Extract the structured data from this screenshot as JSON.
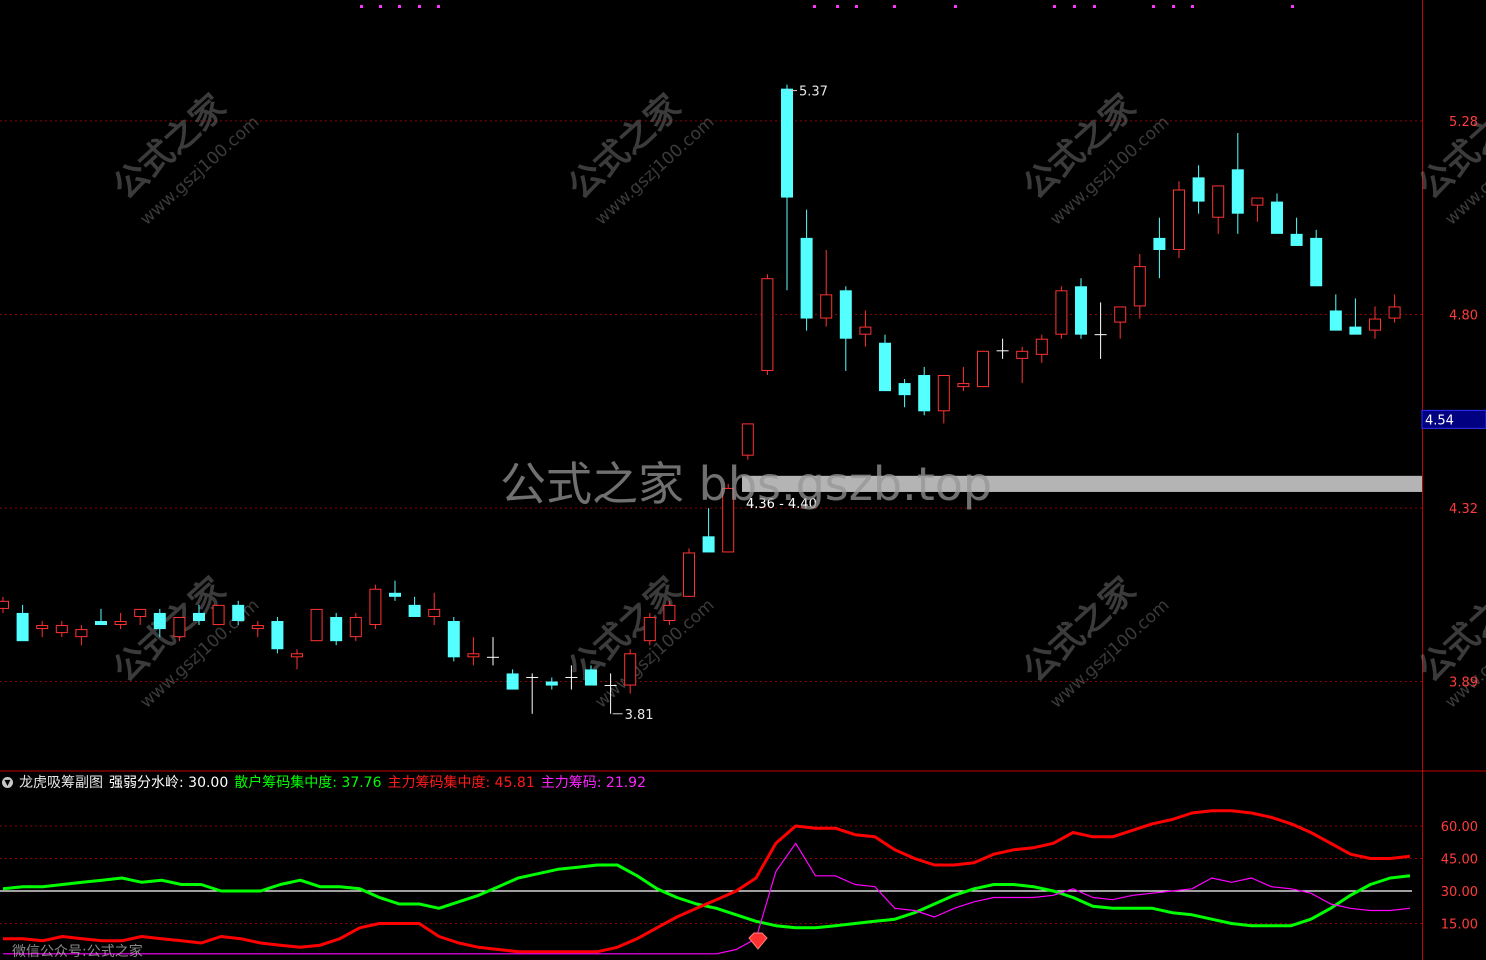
{
  "colors": {
    "background": "#000000",
    "up_candle": "#ff3232",
    "down_candle": "#54ffff",
    "doji": "#ffffff",
    "grid": "#8b0000",
    "axis_line": "#c00000",
    "axis_text": "#ff3c3c",
    "retail_line": "#00ff00",
    "main_line": "#ff0000",
    "main_chips_line": "#ff00ff",
    "threshold_line": "#ffffff",
    "price_tag_bg": "#000080",
    "band": "#b4b4b4",
    "watermark": "#8c8c8c"
  },
  "watermark_center": "公式之家 bbs.gszb.top",
  "watermark_tiles": [
    "公式之家",
    "www.gszj100.com"
  ],
  "footer_text": "微信公众号:公式之家",
  "price_panel": {
    "price_tags": [
      "5.28",
      "4.80",
      "4.32",
      "3.89"
    ],
    "current_price": "4.54",
    "high_label": "5.37",
    "low_label": "3.81",
    "band_label": "4.36 - 4.40",
    "band_low": 4.36,
    "band_high": 4.4
  },
  "indicator_panel": {
    "title": "龙虎吸筹副图",
    "threshold_label": "强弱分水岭: 30.00",
    "retail_label": "散户筹码集中度: 37.76",
    "main_label": "主力筹码集中度: 45.81",
    "main_chips_label": "主力筹码: 21.92",
    "tick_labels": [
      "60.00",
      "45.00",
      "30.00",
      "15.00"
    ]
  },
  "chart_data": [
    {
      "type": "candlestick",
      "title": "",
      "ylim": [
        3.74,
        5.56
      ],
      "gridlines": [
        5.28,
        4.8,
        4.32,
        3.89
      ],
      "candles": [
        {
          "o": 4.07,
          "h": 4.1,
          "l": 4.06,
          "c": 4.09
        },
        {
          "o": 4.06,
          "h": 4.08,
          "l": 4.0,
          "c": 3.99
        },
        {
          "o": 4.02,
          "h": 4.04,
          "l": 4.0,
          "c": 4.03
        },
        {
          "o": 4.01,
          "h": 4.04,
          "l": 4.0,
          "c": 4.03
        },
        {
          "o": 4.0,
          "h": 4.03,
          "l": 3.98,
          "c": 4.02
        },
        {
          "o": 4.04,
          "h": 4.07,
          "l": 4.03,
          "c": 4.03
        },
        {
          "o": 4.03,
          "h": 4.06,
          "l": 4.02,
          "c": 4.04
        },
        {
          "o": 4.05,
          "h": 4.07,
          "l": 4.03,
          "c": 4.07
        },
        {
          "o": 4.06,
          "h": 4.07,
          "l": 4.0,
          "c": 4.02
        },
        {
          "o": 4.0,
          "h": 4.05,
          "l": 3.99,
          "c": 4.05
        },
        {
          "o": 4.06,
          "h": 4.08,
          "l": 4.03,
          "c": 4.04
        },
        {
          "o": 4.03,
          "h": 4.08,
          "l": 4.03,
          "c": 4.08
        },
        {
          "o": 4.08,
          "h": 4.09,
          "l": 4.03,
          "c": 4.04
        },
        {
          "o": 4.02,
          "h": 4.04,
          "l": 4.0,
          "c": 4.03
        },
        {
          "o": 4.04,
          "h": 4.05,
          "l": 3.96,
          "c": 3.97
        },
        {
          "o": 3.95,
          "h": 3.97,
          "l": 3.92,
          "c": 3.96
        },
        {
          "o": 3.99,
          "h": 4.07,
          "l": 3.99,
          "c": 4.07
        },
        {
          "o": 4.05,
          "h": 4.06,
          "l": 3.98,
          "c": 3.99
        },
        {
          "o": 4.0,
          "h": 4.06,
          "l": 3.99,
          "c": 4.05
        },
        {
          "o": 4.03,
          "h": 4.13,
          "l": 4.02,
          "c": 4.12
        },
        {
          "o": 4.11,
          "h": 4.14,
          "l": 4.09,
          "c": 4.1
        },
        {
          "o": 4.08,
          "h": 4.1,
          "l": 4.05,
          "c": 4.05
        },
        {
          "o": 4.05,
          "h": 4.11,
          "l": 4.03,
          "c": 4.07
        },
        {
          "o": 4.04,
          "h": 4.05,
          "l": 3.94,
          "c": 3.95
        },
        {
          "o": 3.95,
          "h": 4.0,
          "l": 3.93,
          "c": 3.96
        },
        {
          "o": 3.95,
          "h": 4.0,
          "l": 3.93,
          "c": 3.95
        },
        {
          "o": 3.91,
          "h": 3.92,
          "l": 3.87,
          "c": 3.87
        },
        {
          "o": 3.9,
          "h": 3.91,
          "l": 3.81,
          "c": 3.9
        },
        {
          "o": 3.89,
          "h": 3.9,
          "l": 3.87,
          "c": 3.88
        },
        {
          "o": 3.9,
          "h": 3.93,
          "l": 3.87,
          "c": 3.9
        },
        {
          "o": 3.92,
          "h": 3.93,
          "l": 3.88,
          "c": 3.88
        },
        {
          "o": 3.88,
          "h": 3.91,
          "l": 3.81,
          "c": 3.88
        },
        {
          "o": 3.88,
          "h": 3.97,
          "l": 3.86,
          "c": 3.96
        },
        {
          "o": 3.99,
          "h": 4.06,
          "l": 3.98,
          "c": 4.05
        },
        {
          "o": 4.04,
          "h": 4.09,
          "l": 4.03,
          "c": 4.08
        },
        {
          "o": 4.1,
          "h": 4.22,
          "l": 4.1,
          "c": 4.21
        },
        {
          "o": 4.25,
          "h": 4.32,
          "l": 4.21,
          "c": 4.21
        },
        {
          "o": 4.21,
          "h": 4.38,
          "l": 4.21,
          "c": 4.37
        },
        {
          "o": 4.45,
          "h": 4.52,
          "l": 4.44,
          "c": 4.53
        },
        {
          "o": 4.66,
          "h": 4.9,
          "l": 4.65,
          "c": 4.89
        },
        {
          "o": 5.36,
          "h": 5.37,
          "l": 4.86,
          "c": 5.09
        },
        {
          "o": 4.99,
          "h": 5.06,
          "l": 4.76,
          "c": 4.79
        },
        {
          "o": 4.79,
          "h": 4.96,
          "l": 4.77,
          "c": 4.85
        },
        {
          "o": 4.86,
          "h": 4.87,
          "l": 4.66,
          "c": 4.74
        },
        {
          "o": 4.75,
          "h": 4.81,
          "l": 4.72,
          "c": 4.77
        },
        {
          "o": 4.73,
          "h": 4.75,
          "l": 4.62,
          "c": 4.61
        },
        {
          "o": 4.63,
          "h": 4.64,
          "l": 4.57,
          "c": 4.6
        },
        {
          "o": 4.65,
          "h": 4.67,
          "l": 4.55,
          "c": 4.56
        },
        {
          "o": 4.56,
          "h": 4.64,
          "l": 4.53,
          "c": 4.65
        },
        {
          "o": 4.62,
          "h": 4.67,
          "l": 4.61,
          "c": 4.63
        },
        {
          "o": 4.62,
          "h": 4.71,
          "l": 4.62,
          "c": 4.71
        },
        {
          "o": 4.71,
          "h": 4.74,
          "l": 4.69,
          "c": 4.71
        },
        {
          "o": 4.69,
          "h": 4.72,
          "l": 4.63,
          "c": 4.71
        },
        {
          "o": 4.7,
          "h": 4.75,
          "l": 4.68,
          "c": 4.74
        },
        {
          "o": 4.75,
          "h": 4.87,
          "l": 4.74,
          "c": 4.86
        },
        {
          "o": 4.87,
          "h": 4.89,
          "l": 4.74,
          "c": 4.75
        },
        {
          "o": 4.75,
          "h": 4.83,
          "l": 4.69,
          "c": 4.75
        },
        {
          "o": 4.78,
          "h": 4.81,
          "l": 4.74,
          "c": 4.82
        },
        {
          "o": 4.82,
          "h": 4.95,
          "l": 4.79,
          "c": 4.92
        },
        {
          "o": 4.99,
          "h": 5.04,
          "l": 4.89,
          "c": 4.96
        },
        {
          "o": 4.96,
          "h": 5.13,
          "l": 4.94,
          "c": 5.11
        },
        {
          "o": 5.14,
          "h": 5.17,
          "l": 5.05,
          "c": 5.08
        },
        {
          "o": 5.04,
          "h": 5.12,
          "l": 5.0,
          "c": 5.12
        },
        {
          "o": 5.16,
          "h": 5.25,
          "l": 5.0,
          "c": 5.05
        },
        {
          "o": 5.07,
          "h": 5.09,
          "l": 5.03,
          "c": 5.09
        },
        {
          "o": 5.08,
          "h": 5.1,
          "l": 5.01,
          "c": 5.0
        },
        {
          "o": 5.0,
          "h": 5.04,
          "l": 4.97,
          "c": 4.97
        },
        {
          "o": 4.99,
          "h": 5.01,
          "l": 4.88,
          "c": 4.87
        },
        {
          "o": 4.81,
          "h": 4.85,
          "l": 4.76,
          "c": 4.76
        },
        {
          "o": 4.77,
          "h": 4.84,
          "l": 4.76,
          "c": 4.75
        },
        {
          "o": 4.76,
          "h": 4.82,
          "l": 4.74,
          "c": 4.79
        },
        {
          "o": 4.79,
          "h": 4.85,
          "l": 4.78,
          "c": 4.82
        }
      ]
    },
    {
      "type": "line",
      "title": "龙虎吸筹副图",
      "ylim": [
        0,
        72
      ],
      "gridlines": [
        60,
        45,
        30,
        15
      ],
      "series": [
        {
          "name": "强弱分水岭",
          "values": [
            30,
            30,
            30,
            30,
            30,
            30,
            30,
            30,
            30,
            30,
            30,
            30,
            30,
            30,
            30,
            30,
            30,
            30,
            30,
            30,
            30,
            30,
            30,
            30,
            30,
            30,
            30,
            30,
            30,
            30,
            30,
            30,
            30,
            30,
            30,
            30,
            30,
            30,
            30,
            30,
            30,
            30,
            30,
            30,
            30,
            30,
            30,
            30,
            30,
            30,
            30,
            30,
            30,
            30,
            30,
            30,
            30,
            30,
            30,
            30,
            30,
            30,
            30,
            30,
            30,
            30,
            30,
            30,
            30,
            30,
            30,
            30
          ]
        },
        {
          "name": "散户筹码集中度",
          "values": [
            31,
            32,
            32,
            33,
            34,
            35,
            36,
            34,
            35,
            33,
            33,
            30,
            30,
            30,
            33,
            35,
            32,
            32,
            31,
            27,
            24,
            24,
            22,
            25,
            28,
            32,
            36,
            38,
            40,
            41,
            42,
            42,
            37,
            31,
            27,
            24,
            22,
            19,
            16,
            14,
            13,
            13,
            14,
            15,
            16,
            17,
            20,
            24,
            28,
            31,
            33,
            33,
            32,
            30,
            27,
            23,
            22,
            22,
            22,
            20,
            19,
            17,
            15,
            14,
            14,
            14,
            17,
            22,
            28,
            33,
            36,
            37
          ]
        },
        {
          "name": "主力筹码集中度",
          "values": [
            8,
            8,
            7,
            9,
            8,
            7,
            7,
            9,
            8,
            7,
            6,
            9,
            8,
            6,
            5,
            4,
            5,
            8,
            13,
            15,
            15,
            15,
            9,
            6,
            4,
            3,
            2,
            2,
            2,
            2,
            2,
            4,
            8,
            13,
            18,
            22,
            26,
            30,
            36,
            52,
            60,
            59,
            59,
            56,
            55,
            49,
            45,
            42,
            42,
            43,
            47,
            49,
            50,
            52,
            57,
            55,
            55,
            58,
            61,
            63,
            66,
            67,
            67,
            66,
            64,
            61,
            57,
            52,
            47,
            45,
            45,
            46
          ]
        },
        {
          "name": "主力筹码",
          "values": [
            1,
            1,
            1,
            1,
            1,
            1,
            1,
            1,
            1,
            1,
            1,
            1,
            1,
            1,
            1,
            1,
            1,
            1,
            1,
            1,
            1,
            1,
            1,
            1,
            1,
            1,
            1,
            1,
            1,
            1,
            1,
            1,
            1,
            1,
            1,
            1,
            1,
            3,
            8,
            39,
            52,
            37,
            37,
            33,
            32,
            22,
            21,
            18,
            22,
            25,
            27,
            27,
            27,
            28,
            31,
            27,
            26,
            28,
            29,
            30,
            31,
            36,
            34,
            36,
            32,
            31,
            29,
            24,
            22,
            21,
            21,
            22
          ]
        }
      ]
    }
  ]
}
